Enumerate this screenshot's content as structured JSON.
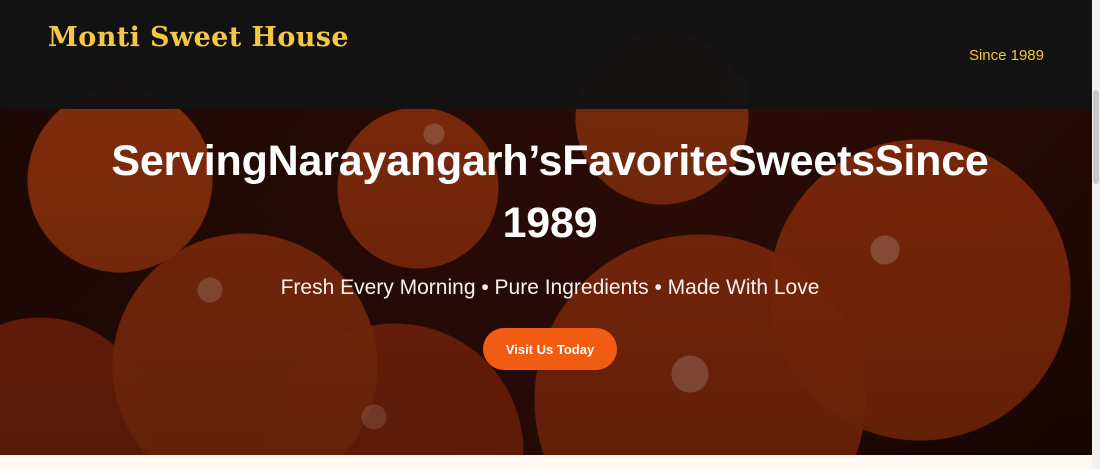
{
  "brand": {
    "name": "Monti Sweet House"
  },
  "header": {
    "since": "Since 1989"
  },
  "hero": {
    "headline": "ServingNarayangarh’sFavoriteSweetsSince1989",
    "subheadline": "Fresh Every Morning • Pure Ingredients • Made With Love",
    "cta_label": "Visit Us Today"
  },
  "colors": {
    "accent_orange": "#f15c12",
    "gold": "#f6c744",
    "header_bg": "#131313",
    "white": "#ffffff"
  }
}
